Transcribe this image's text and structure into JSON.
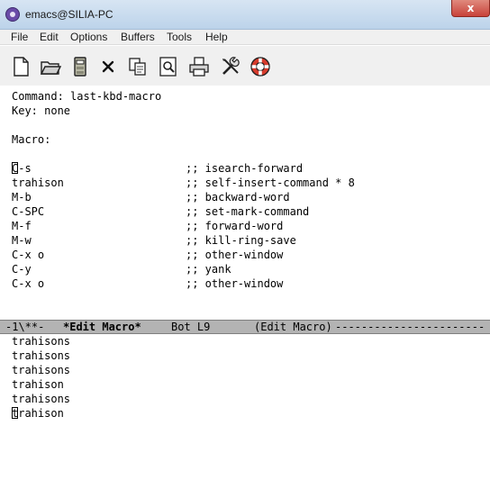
{
  "window": {
    "title": "emacs@SILIA-PC",
    "close_label": "x"
  },
  "menubar": {
    "items": [
      "File",
      "Edit",
      "Options",
      "Buffers",
      "Tools",
      "Help"
    ]
  },
  "toolbar": {
    "icons": [
      "new-file-icon",
      "open-folder-icon",
      "save-icon",
      "close-buffer-icon",
      "copy-icon",
      "search-icon",
      "print-icon",
      "tools-icon",
      "help-lifebuoy-icon"
    ]
  },
  "edit_macro": {
    "header": [
      "Command: last-kbd-macro",
      "Key: none",
      "",
      "Macro:"
    ],
    "lines": [
      {
        "keys": "C-s",
        "comment": ";; isearch-forward"
      },
      {
        "keys": "trahison",
        "comment": ";; self-insert-command * 8"
      },
      {
        "keys": "M-b",
        "comment": ";; backward-word"
      },
      {
        "keys": "C-SPC",
        "comment": ";; set-mark-command"
      },
      {
        "keys": "M-f",
        "comment": ";; forward-word"
      },
      {
        "keys": "M-w",
        "comment": ";; kill-ring-save"
      },
      {
        "keys": "C-x o",
        "comment": ";; other-window"
      },
      {
        "keys": "C-y",
        "comment": ";; yank"
      },
      {
        "keys": "C-x o",
        "comment": ";; other-window"
      }
    ]
  },
  "modeline": {
    "status": "-1\\**-",
    "buffer_name": "*Edit Macro*",
    "position": "Bot L9",
    "mode": "(Edit Macro)",
    "filler": "-----------------------"
  },
  "lower_buffer": {
    "lines": [
      "trahisons",
      "trahisons",
      "trahisons",
      "trahison",
      "trahisons",
      "trahison"
    ]
  },
  "colors": {
    "modeline_bg": "#b3b3b3",
    "toolbar_bg": "#f0f0f0",
    "titlebar_bg": "#c8dbee"
  }
}
